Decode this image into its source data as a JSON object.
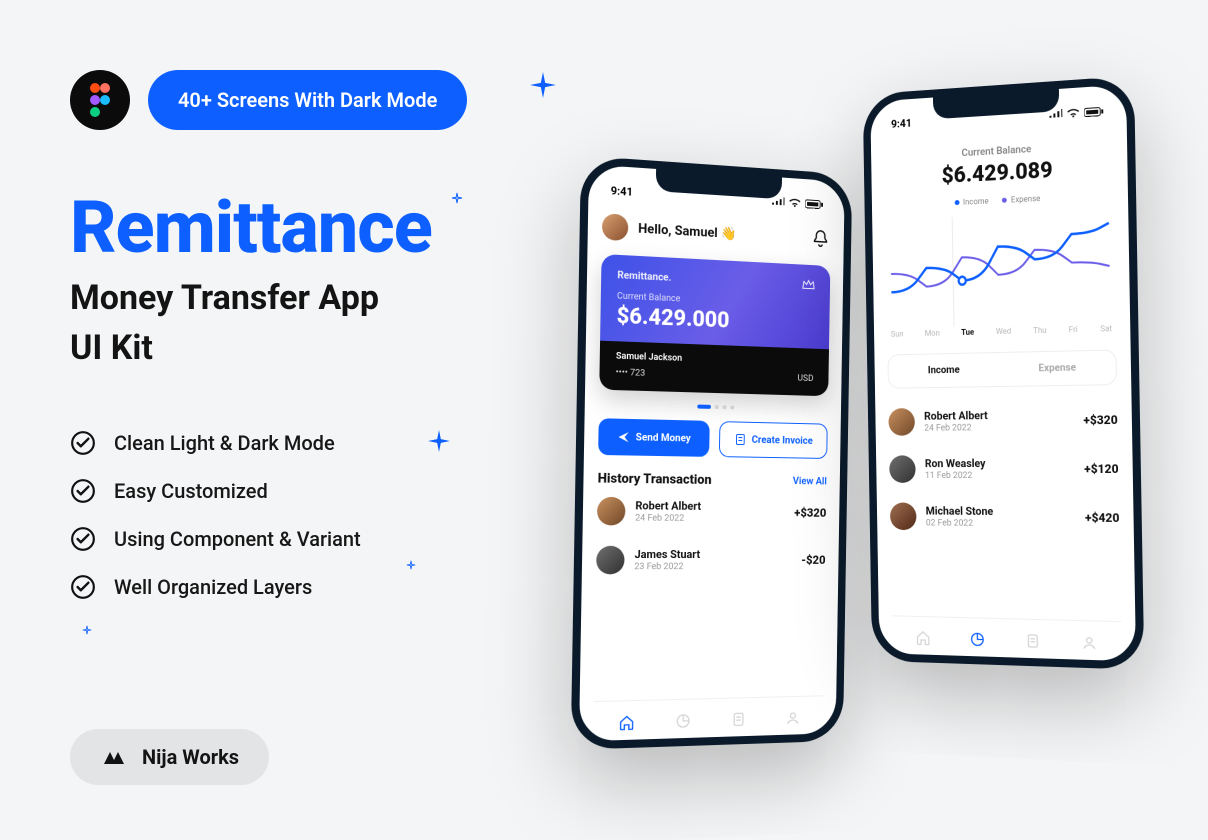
{
  "header": {
    "badge": "40+ Screens With Dark Mode",
    "title": "Remittance",
    "subtitle_line1": "Money Transfer App",
    "subtitle_line2": "UI Kit"
  },
  "features": [
    "Clean Light & Dark Mode",
    "Easy Customized",
    "Using Component & Variant",
    "Well Organized Layers"
  ],
  "brand": "Nija Works",
  "colors": {
    "accent": "#0d60ff",
    "purple": "#6a5de8"
  },
  "phoneA": {
    "time": "9:41",
    "greeting": "Hello, Samuel 👋",
    "card": {
      "brand": "Remittance.",
      "balance_label": "Current Balance",
      "balance": "$6.429.000",
      "holder": "Samuel Jackson",
      "last_digits": "•••• 723",
      "currency": "USD"
    },
    "actions": {
      "send": "Send Money",
      "invoice": "Create Invoice"
    },
    "history": {
      "title": "History Transaction",
      "view_all": "View All"
    },
    "transactions": [
      {
        "name": "Robert Albert",
        "date": "24 Feb 2022",
        "amount": "+$320"
      },
      {
        "name": "James Stuart",
        "date": "23 Feb 2022",
        "amount": "-$20"
      }
    ]
  },
  "phoneB": {
    "time": "9:41",
    "balance_label": "Current Balance",
    "balance": "$6.429.089",
    "legend": {
      "income": "Income",
      "expense": "Expense"
    },
    "days": [
      "Sun",
      "Mon",
      "Tue",
      "Wed",
      "Thu",
      "Fri",
      "Sat"
    ],
    "selected_day_index": 2,
    "segments": {
      "income": "Income",
      "expense": "Expense"
    },
    "transactions": [
      {
        "name": "Robert Albert",
        "date": "24 Feb 2022",
        "amount": "+$320"
      },
      {
        "name": "Ron Weasley",
        "date": "11 Feb 2022",
        "amount": "+$120"
      },
      {
        "name": "Michael Stone",
        "date": "02 Feb 2022",
        "amount": "+$420"
      }
    ]
  },
  "chart_data": {
    "type": "line",
    "categories": [
      "Sun",
      "Mon",
      "Tue",
      "Wed",
      "Thu",
      "Fri",
      "Sat"
    ],
    "series": [
      {
        "name": "Income",
        "values": [
          30,
          55,
          40,
          75,
          60,
          85,
          95
        ]
      },
      {
        "name": "Expense",
        "values": [
          50,
          35,
          65,
          45,
          70,
          55,
          50
        ]
      }
    ],
    "ylim": [
      0,
      100
    ],
    "legend_position": "top"
  }
}
